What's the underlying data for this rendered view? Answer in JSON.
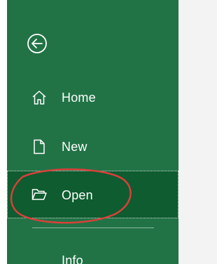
{
  "sidebar": {
    "back_icon": "circle-arrow-left-icon",
    "items": [
      {
        "label": "Home",
        "icon": "home-icon"
      },
      {
        "label": "New",
        "icon": "new-document-icon"
      },
      {
        "label": "Open",
        "icon": "folder-open-icon",
        "selected": true
      },
      {
        "label": "Info",
        "icon": ""
      }
    ]
  },
  "colors": {
    "sidebar_bg": "#217346",
    "selected_bg": "#0e5c2f",
    "annotation": "#d9403b",
    "content_bg": "#f3f3f3"
  }
}
